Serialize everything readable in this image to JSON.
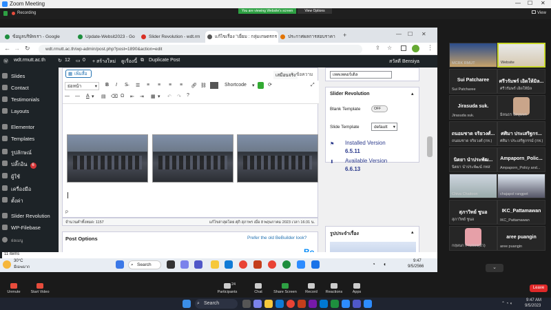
{
  "zoom": {
    "title": "Zoom Meeting",
    "recording": "Recording",
    "viewing_banner": "You are viewing Website's screen",
    "view_options": "View Options",
    "view": "View",
    "unmute": "Unmute",
    "start_video": "Start Video",
    "participants": "Participants",
    "participants_count": "24",
    "chat": "Chat",
    "share_screen": "Share Screen",
    "record": "Record",
    "reactions": "Reactions",
    "apps": "Apps",
    "leave": "Leave"
  },
  "tabs": [
    {
      "label": "ข้อมูลบริษัทเรา - Google",
      "color": "#1e8e3e"
    },
    {
      "label": "Update-Websit2023 - Go",
      "color": "#1e8e3e"
    },
    {
      "label": "Slider Revolution - wdt.rm",
      "color": "#d93025"
    },
    {
      "label": "แก้ไขเรื่อง \"เยี่ยม : กลุ่มเกษตรกร",
      "color": "#555"
    },
    {
      "label": "ประกาศผลการสอบราคา",
      "color": "#e37400"
    }
  ],
  "url": "wdt.rmutt.ac.th/wp-admin/post.php?post=1890&action=edit",
  "wp_admin_bar": {
    "site": "wdt.rmutt.ac.th",
    "comments": "12",
    "updates": "0",
    "new": "+ สร้างใหม่",
    "view_post": "ดูเรื่องนี้",
    "duplicate": "Duplicate Post",
    "howdy": "สวัสดี Bensiya"
  },
  "sidebar": [
    "Slides",
    "Contact",
    "Testimonials",
    "Layouts",
    "Elementor",
    "Templates",
    "รูปลักษณ์",
    "ปลั๊กอิน",
    "ผู้ใช้",
    "เครื่องมือ",
    "ตั้งค่า",
    "Slider Revolution",
    "WP-Filebase",
    "ย่อเมนู"
  ],
  "plugin_badge": "6",
  "editor": {
    "add_media": "เพิ่มสื่อ",
    "visual_tab": "เสมือนจริง",
    "text_tab": "ข้อความ",
    "format": "ย่อหน้า",
    "shortcode": "Shortcode",
    "path": "P",
    "word_count": "จำนวนคำทั้งหมด: 1157",
    "last_edit": "แก้ไขล่าสุดโดย ศุภิ สุภาพร เมื่อ 8 พฤษภาคม 2023 เวลา 16:31 น."
  },
  "post_options": {
    "title": "Post Options",
    "prefer": "Prefer the old BeBuilder look?",
    "logo": "Be"
  },
  "right": {
    "category_select": "เทคเทคอร์เดิล",
    "slider_title": "Slider Revolution",
    "blank_template": "Blank Template",
    "toggle": "OFF",
    "slide_template": "Slide Template",
    "default": "default",
    "installed_label": "Installed Version",
    "installed": "6.5.11",
    "available_label": "Available Version",
    "available": "6.6.13",
    "featured_title": "รูปประจำเรื่อง"
  },
  "remote_taskbar": {
    "items": "11 items",
    "temp": "30°C",
    "weather": "มีเมฆมาก",
    "search": "Search",
    "time": "9:47",
    "date": "9/5/2566"
  },
  "participants": [
    {
      "name": "",
      "label": "MCRK RMUT",
      "video": true
    },
    {
      "name": "",
      "label": "Website",
      "video": true
    },
    {
      "name": "Sui Patcharee",
      "label": "Sui Patcharee"
    },
    {
      "name": "ศรีวรัมพร์ เอิดให้มิล...",
      "label": "ศรีวรัมพร์ เอิดให้มิล"
    },
    {
      "name": "Jirasuda suk.",
      "label": "Jirasuda suk."
    },
    {
      "name": "",
      "label": "มิลนธร จิลบุษพร",
      "video": true
    },
    {
      "name": "ถนอมชาด จริยวงศ์...",
      "label": "ถนอมชาด จริยวงศ์ (กท.)"
    },
    {
      "name": "ศศิมา ประเสริฐกร...",
      "label": "ศศิมา ประเสริฐกรรม์ (กท.)"
    },
    {
      "name": "นิตยา นำประพัฒ...",
      "label": "นิตยา นำประพัฒน์ กทส"
    },
    {
      "name": "Ampaporn_Polic...",
      "label": "Ampaporn_Policy and..."
    },
    {
      "name": "",
      "label": "Chiva Chaitoon",
      "video": true
    },
    {
      "name": "",
      "label": "chajapol rangpet",
      "video": true
    },
    {
      "name": "สุภาวิทย์ ชูนอ",
      "label": "สุภาวิทย์ ชูนอ"
    },
    {
      "name": "IKC_Pattamawan",
      "label": "IKC_Pattamawan"
    },
    {
      "name": "",
      "label": "กฤษนก ก้ามยอย(ยิว)",
      "video": true
    },
    {
      "name": "aree puangin",
      "label": "aree puangin"
    }
  ],
  "win_taskbar": {
    "search": "Search",
    "time": "9:47 AM",
    "date": "9/5/2023"
  }
}
